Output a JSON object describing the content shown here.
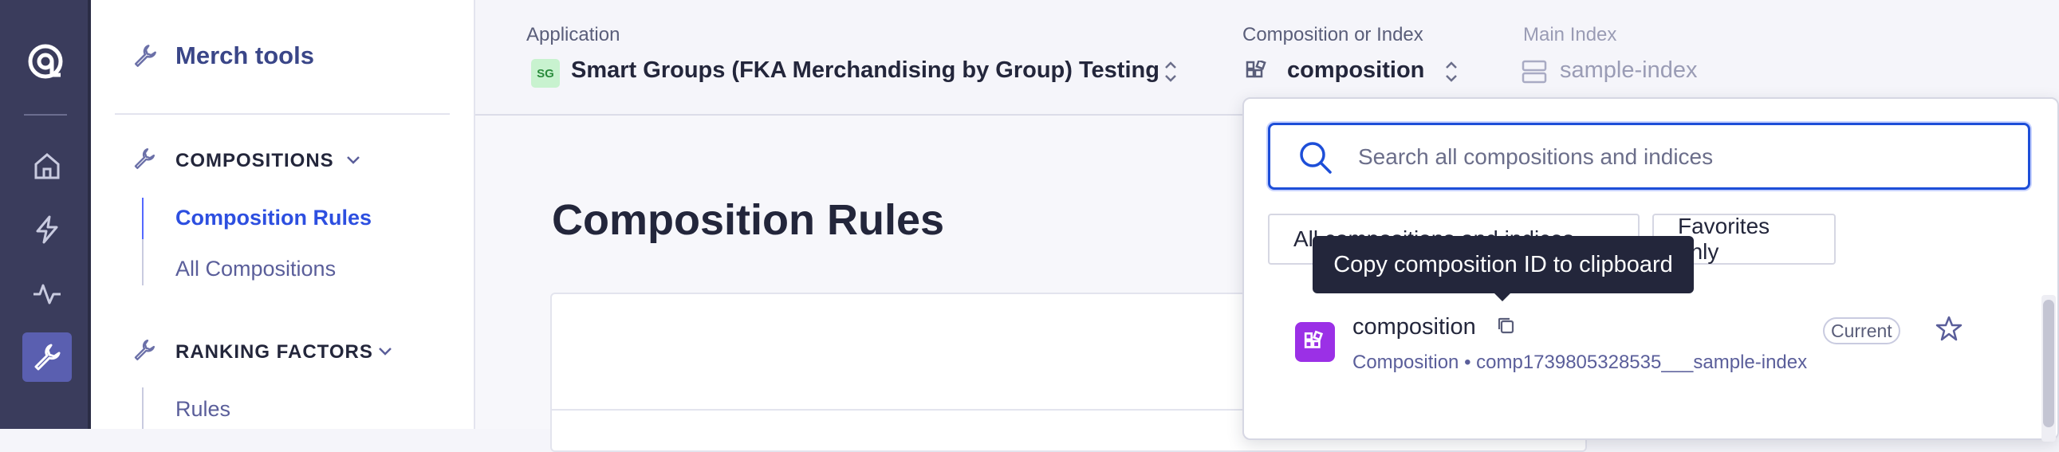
{
  "colors": {
    "rail": "#3a3c5c",
    "accent": "#2d4fe0",
    "brand_title": "#3a4688",
    "composition_icon": "#9b30e6"
  },
  "rail": {
    "icons": [
      "algolia-logo-icon",
      "home-icon",
      "lightning-icon",
      "activity-icon",
      "wrench-icon"
    ]
  },
  "sidebar": {
    "title": "Merch tools",
    "sections": [
      {
        "heading": "COMPOSITIONS",
        "items": [
          "Composition Rules",
          "All Compositions"
        ]
      },
      {
        "heading": "RANKING FACTORS",
        "items": [
          "Rules"
        ]
      }
    ]
  },
  "topbar": {
    "application": {
      "label": "Application",
      "badge": "SG",
      "value": "Smart Groups (FKA Merchandising by Group) Testing"
    },
    "composition": {
      "label": "Composition or Index",
      "value": "composition"
    },
    "main_index": {
      "label": "Main Index",
      "value": "sample-index"
    }
  },
  "main": {
    "page_title": "Composition Rules"
  },
  "dropdown": {
    "search_placeholder": "Search all compositions and indices",
    "filters": [
      "All compositions and indices",
      "Favorites only"
    ],
    "tooltip": "Copy composition ID to clipboard",
    "items": [
      {
        "name": "composition",
        "meta": "Composition • comp1739805328535___sample-index",
        "badge": "Current"
      }
    ]
  }
}
